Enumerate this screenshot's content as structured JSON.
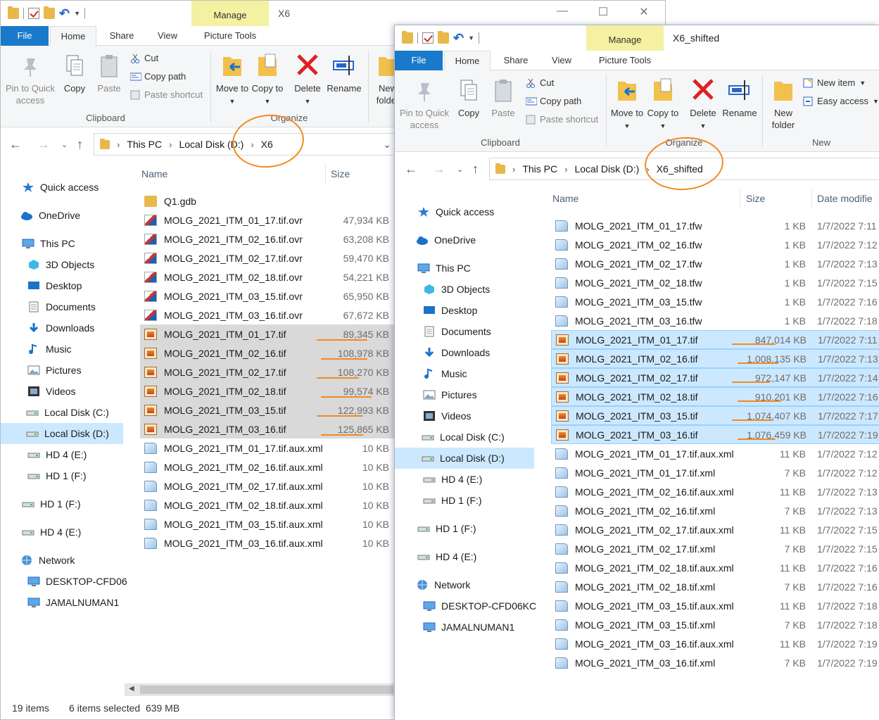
{
  "win1": {
    "title": "X6",
    "context_tab": "Manage",
    "tabs": [
      "File",
      "Home",
      "Share",
      "View",
      "Picture Tools"
    ],
    "ribbon": {
      "pin": "Pin to Quick access",
      "copy": "Copy",
      "paste": "Paste",
      "cut": "Cut",
      "copy_path": "Copy path",
      "paste_shortcut": "Paste shortcut",
      "clipboard": "Clipboard",
      "move_to": "Move to",
      "copy_to": "Copy to",
      "delete": "Delete",
      "rename": "Rename",
      "new_folder": "New folder",
      "organize": "Organize",
      "new_cut": "N"
    },
    "breadcrumb": [
      "This PC",
      "Local Disk (D:)",
      "X6"
    ],
    "columns": {
      "name": "Name",
      "size": "Size"
    },
    "nav": [
      "Quick access",
      "OneDrive",
      "This PC",
      "3D Objects",
      "Desktop",
      "Documents",
      "Downloads",
      "Music",
      "Pictures",
      "Videos",
      "Local Disk (C:)",
      "Local Disk (D:)",
      "HD 4 (E:)",
      "HD 1 (F:)",
      "HD 1 (F:)",
      "HD 4 (E:)",
      "Network",
      "DESKTOP-CFD06",
      "JAMALNUMAN1"
    ],
    "files": [
      {
        "name": "Q1.gdb",
        "size": "",
        "type": "folder"
      },
      {
        "name": "MOLG_2021_ITM_01_17.tif.ovr",
        "size": "47,934 KB",
        "type": "ovr"
      },
      {
        "name": "MOLG_2021_ITM_02_16.tif.ovr",
        "size": "63,208 KB",
        "type": "ovr"
      },
      {
        "name": "MOLG_2021_ITM_02_17.tif.ovr",
        "size": "59,470 KB",
        "type": "ovr"
      },
      {
        "name": "MOLG_2021_ITM_02_18.tif.ovr",
        "size": "54,221 KB",
        "type": "ovr"
      },
      {
        "name": "MOLG_2021_ITM_03_15.tif.ovr",
        "size": "65,950 KB",
        "type": "ovr"
      },
      {
        "name": "MOLG_2021_ITM_03_16.tif.ovr",
        "size": "67,672 KB",
        "type": "ovr"
      },
      {
        "name": "MOLG_2021_ITM_01_17.tif",
        "size": "89,345 KB",
        "type": "tif",
        "selected": true
      },
      {
        "name": "MOLG_2021_ITM_02_16.tif",
        "size": "108,978 KB",
        "type": "tif",
        "selected": true
      },
      {
        "name": "MOLG_2021_ITM_02_17.tif",
        "size": "108,270 KB",
        "type": "tif",
        "selected": true
      },
      {
        "name": "MOLG_2021_ITM_02_18.tif",
        "size": "99,574 KB",
        "type": "tif",
        "selected": true
      },
      {
        "name": "MOLG_2021_ITM_03_15.tif",
        "size": "122,993 KB",
        "type": "tif",
        "selected": true
      },
      {
        "name": "MOLG_2021_ITM_03_16.tif",
        "size": "125,865 KB",
        "type": "tif",
        "selected": true
      },
      {
        "name": "MOLG_2021_ITM_01_17.tif.aux.xml",
        "size": "10 KB",
        "type": "xml"
      },
      {
        "name": "MOLG_2021_ITM_02_16.tif.aux.xml",
        "size": "10 KB",
        "type": "xml"
      },
      {
        "name": "MOLG_2021_ITM_02_17.tif.aux.xml",
        "size": "10 KB",
        "type": "xml"
      },
      {
        "name": "MOLG_2021_ITM_02_18.tif.aux.xml",
        "size": "10 KB",
        "type": "xml"
      },
      {
        "name": "MOLG_2021_ITM_03_15.tif.aux.xml",
        "size": "10 KB",
        "type": "xml"
      },
      {
        "name": "MOLG_2021_ITM_03_16.tif.aux.xml",
        "size": "10 KB",
        "type": "xml"
      }
    ],
    "status_items": "19 items",
    "status_selected": "6 items selected  639 MB"
  },
  "win2": {
    "title": "X6_shifted",
    "context_tab": "Manage",
    "tabs": [
      "File",
      "Home",
      "Share",
      "View",
      "Picture Tools"
    ],
    "ribbon": {
      "pin": "Pin to Quick access",
      "copy": "Copy",
      "paste": "Paste",
      "cut": "Cut",
      "copy_path": "Copy path",
      "paste_shortcut": "Paste shortcut",
      "clipboard": "Clipboard",
      "move_to": "Move to",
      "copy_to": "Copy to",
      "delete": "Delete",
      "rename": "Rename",
      "organize": "Organize",
      "new_folder": "New folder",
      "new_item": "New item",
      "easy_access": "Easy access",
      "new": "New"
    },
    "breadcrumb": [
      "This PC",
      "Local Disk (D:)",
      "X6_shifted"
    ],
    "columns": {
      "name": "Name",
      "size": "Size",
      "date": "Date modifie"
    },
    "nav": [
      "Quick access",
      "OneDrive",
      "This PC",
      "3D Objects",
      "Desktop",
      "Documents",
      "Downloads",
      "Music",
      "Pictures",
      "Videos",
      "Local Disk (C:)",
      "Local Disk (D:)",
      "HD 4 (E:)",
      "HD 1 (F:)",
      "HD 1 (F:)",
      "HD 4 (E:)",
      "Network",
      "DESKTOP-CFD06KC",
      "JAMALNUMAN1"
    ],
    "files": [
      {
        "name": "MOLG_2021_ITM_01_17.tfw",
        "size": "1 KB",
        "date": "1/7/2022 7:11",
        "type": "xml"
      },
      {
        "name": "MOLG_2021_ITM_02_16.tfw",
        "size": "1 KB",
        "date": "1/7/2022 7:12",
        "type": "xml"
      },
      {
        "name": "MOLG_2021_ITM_02_17.tfw",
        "size": "1 KB",
        "date": "1/7/2022 7:13",
        "type": "xml"
      },
      {
        "name": "MOLG_2021_ITM_02_18.tfw",
        "size": "1 KB",
        "date": "1/7/2022 7:15",
        "type": "xml"
      },
      {
        "name": "MOLG_2021_ITM_03_15.tfw",
        "size": "1 KB",
        "date": "1/7/2022 7:16",
        "type": "xml"
      },
      {
        "name": "MOLG_2021_ITM_03_16.tfw",
        "size": "1 KB",
        "date": "1/7/2022 7:18",
        "type": "xml"
      },
      {
        "name": "MOLG_2021_ITM_01_17.tif",
        "size": "847,014 KB",
        "date": "1/7/2022 7:11",
        "type": "tif",
        "selected": true
      },
      {
        "name": "MOLG_2021_ITM_02_16.tif",
        "size": "1,008,135 KB",
        "date": "1/7/2022 7:13",
        "type": "tif",
        "selected": true
      },
      {
        "name": "MOLG_2021_ITM_02_17.tif",
        "size": "972,147 KB",
        "date": "1/7/2022 7:14",
        "type": "tif",
        "selected": true
      },
      {
        "name": "MOLG_2021_ITM_02_18.tif",
        "size": "910,201 KB",
        "date": "1/7/2022 7:16",
        "type": "tif",
        "selected": true
      },
      {
        "name": "MOLG_2021_ITM_03_15.tif",
        "size": "1,074,407 KB",
        "date": "1/7/2022 7:17",
        "type": "tif",
        "selected": true
      },
      {
        "name": "MOLG_2021_ITM_03_16.tif",
        "size": "1,076,459 KB",
        "date": "1/7/2022 7:19",
        "type": "tif",
        "selected": true
      },
      {
        "name": "MOLG_2021_ITM_01_17.tif.aux.xml",
        "size": "11 KB",
        "date": "1/7/2022 7:12",
        "type": "xml"
      },
      {
        "name": "MOLG_2021_ITM_01_17.tif.xml",
        "size": "7 KB",
        "date": "1/7/2022 7:12",
        "type": "xml"
      },
      {
        "name": "MOLG_2021_ITM_02_16.tif.aux.xml",
        "size": "11 KB",
        "date": "1/7/2022 7:13",
        "type": "xml"
      },
      {
        "name": "MOLG_2021_ITM_02_16.tif.xml",
        "size": "7 KB",
        "date": "1/7/2022 7:13",
        "type": "xml"
      },
      {
        "name": "MOLG_2021_ITM_02_17.tif.aux.xml",
        "size": "11 KB",
        "date": "1/7/2022 7:15",
        "type": "xml"
      },
      {
        "name": "MOLG_2021_ITM_02_17.tif.xml",
        "size": "7 KB",
        "date": "1/7/2022 7:15",
        "type": "xml"
      },
      {
        "name": "MOLG_2021_ITM_02_18.tif.aux.xml",
        "size": "11 KB",
        "date": "1/7/2022 7:16",
        "type": "xml"
      },
      {
        "name": "MOLG_2021_ITM_02_18.tif.xml",
        "size": "7 KB",
        "date": "1/7/2022 7:16",
        "type": "xml"
      },
      {
        "name": "MOLG_2021_ITM_03_15.tif.aux.xml",
        "size": "11 KB",
        "date": "1/7/2022 7:18",
        "type": "xml"
      },
      {
        "name": "MOLG_2021_ITM_03_15.tif.xml",
        "size": "7 KB",
        "date": "1/7/2022 7:18",
        "type": "xml"
      },
      {
        "name": "MOLG_2021_ITM_03_16.tif.aux.xml",
        "size": "11 KB",
        "date": "1/7/2022 7:19",
        "type": "xml"
      },
      {
        "name": "MOLG_2021_ITM_03_16.tif.xml",
        "size": "7 KB",
        "date": "1/7/2022 7:19",
        "type": "xml"
      }
    ]
  },
  "colors": {
    "file_tab": "#1979ca",
    "context_tab": "#f4f1a2",
    "selection_gray": "#d9d9d9",
    "selection_blue": "#cce8ff",
    "annotation": "#f08a22"
  },
  "icons": [
    "folder-icon",
    "check-icon",
    "undo-icon",
    "pin-icon",
    "copy-icon",
    "paste-icon",
    "scissors-icon",
    "copy-path-icon",
    "shortcut-icon",
    "move-to-icon",
    "copy-to-icon",
    "delete-icon",
    "rename-icon",
    "new-folder-icon",
    "new-item-icon",
    "easy-access-icon",
    "back-arrow-icon",
    "forward-arrow-icon",
    "up-arrow-icon",
    "star-icon",
    "cloud-icon",
    "pc-icon",
    "drive-icon",
    "network-icon",
    "tif-file-icon",
    "xml-file-icon",
    "ovr-file-icon"
  ]
}
